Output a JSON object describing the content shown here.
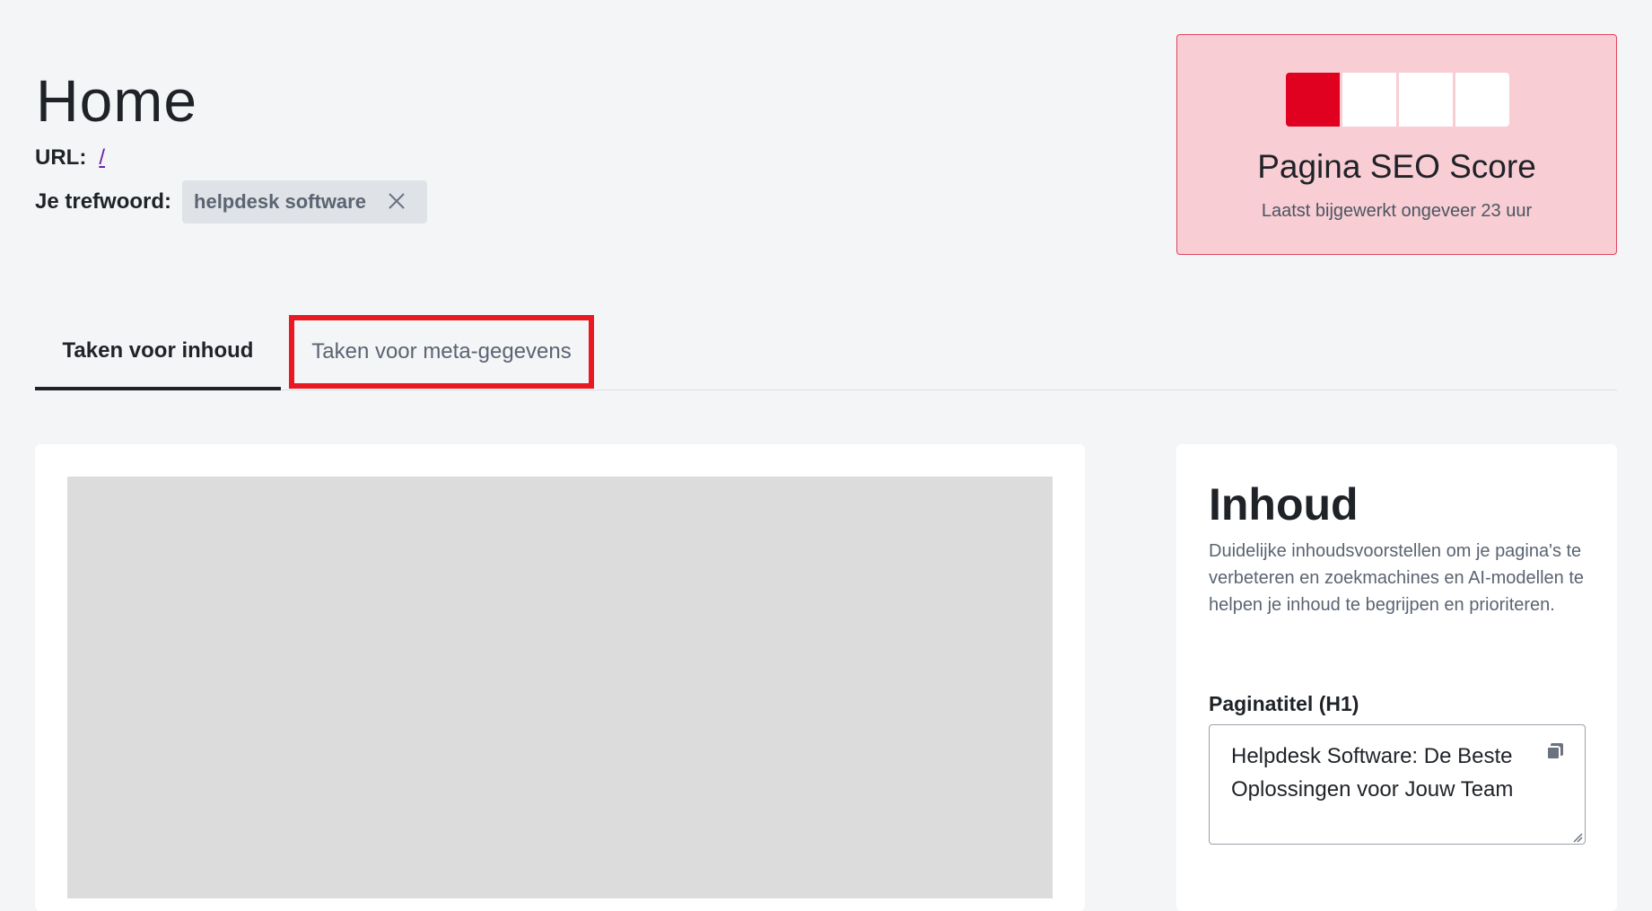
{
  "header": {
    "title": "Home",
    "url_label": "URL:",
    "url_value": "/",
    "keyword_label": "Je trefwoord:",
    "keyword_value": "helpdesk software",
    "keyword_remove_icon": "close-icon"
  },
  "score": {
    "title": "Pagina SEO Score",
    "subtitle": "Laatst bijgewerkt ongeveer 23 uur",
    "filled_segments": 1,
    "total_segments": 4,
    "colors": {
      "card_bg": "#f8cdd3",
      "fill": "#e0001f"
    }
  },
  "tabs": [
    {
      "label": "Taken voor inhoud",
      "active": true
    },
    {
      "label": "Taken voor meta-gegevens",
      "active": false,
      "highlighted": true
    }
  ],
  "content_panel": {
    "title": "Inhoud",
    "description": "Duidelijke inhoudsvoorstellen om je pagina's te verbeteren en zoekmachines en AI-modellen te helpen je inhoud te begrijpen en prioriteren.",
    "field_label": "Paginatitel (H1)",
    "field_value": "Helpdesk Software: De Beste Oplossingen voor Jouw Team",
    "copy_icon": "copy-icon"
  },
  "colors": {
    "highlight_border": "#e81920",
    "accent_link": "#6b21a8"
  }
}
